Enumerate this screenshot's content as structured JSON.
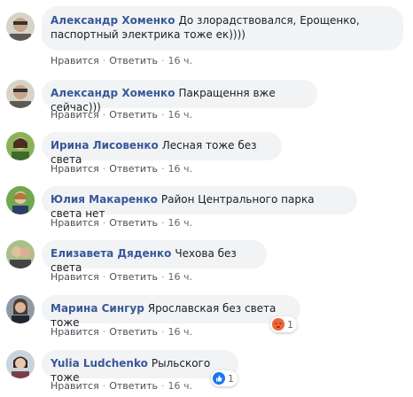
{
  "comments": [
    {
      "author": "Александр Хоменко",
      "line1": "До злорадствовался, Ерощенко,",
      "line2": "паспортный электрика тоже ек))))",
      "like": "Нравится",
      "reply": "Ответить",
      "time": "16 ч."
    },
    {
      "author": "Александр Хоменко",
      "text": "Пакращення вже сейчас)))",
      "like": "Нравится",
      "reply": "Ответить",
      "time": "16 ч."
    },
    {
      "author": "Ирина Лисовенко",
      "text": "Лесная тоже без света",
      "like": "Нравится",
      "reply": "Ответить",
      "time": "16 ч."
    },
    {
      "author": "Юлия Макаренко",
      "text": "Район Центрального парка света нет",
      "like": "Нравится",
      "reply": "Ответить",
      "time": "16 ч."
    },
    {
      "author": "Елизавета Дяденко",
      "text": "Чехова без света",
      "like": "Нравится",
      "reply": "Ответить",
      "time": "16 ч."
    },
    {
      "author": "Марина Сингур",
      "text": "Ярославская без света тоже",
      "like": "Нравится",
      "reply": "Ответить",
      "time": "16 ч.",
      "reaction": {
        "icon": "angry-reaction-icon",
        "count": "1",
        "color": "#f0653b"
      }
    },
    {
      "author": "Yulia Ludchenko",
      "text": "Рыльского тоже",
      "like": "Нравится",
      "reply": "Ответить",
      "time": "16 ч.",
      "reaction": {
        "icon": "like-reaction-icon",
        "count": "1",
        "color": "#1877f2"
      }
    }
  ]
}
